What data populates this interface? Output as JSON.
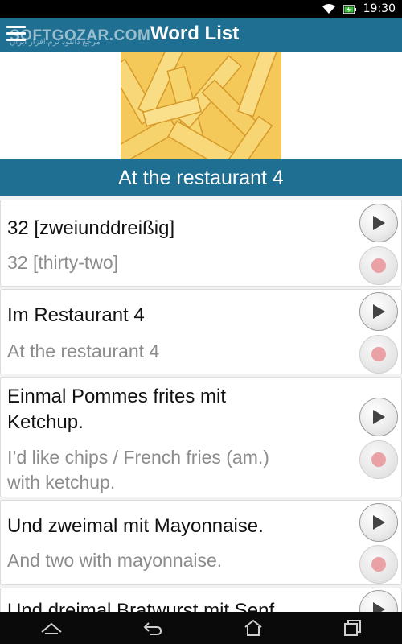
{
  "status_bar": {
    "time": "19:30",
    "icons": [
      "wifi-icon",
      "battery-charging-icon"
    ]
  },
  "app_bar": {
    "title": "Word List",
    "watermark": "SOFTGOZAR.COM",
    "watermark_sub": "مرجع دانلود نرم افزار ایران",
    "menu_icon": "hamburger-menu-icon"
  },
  "hero": {
    "image": "french-fries-photo"
  },
  "section": {
    "title": "At the restaurant 4"
  },
  "phrases": [
    {
      "german": "32 [zweiunddreißig]",
      "english": "32 [thirty-two]"
    },
    {
      "german": "Im Restaurant 4",
      "english": "At the restaurant 4"
    },
    {
      "german_lines": [
        "Einmal Pommes frites mit",
        "Ketchup."
      ],
      "english_lines": [
        "I’d like chips / French fries (am.)",
        "with ketchup."
      ]
    },
    {
      "german": "Und zweimal mit Mayonnaise.",
      "english": "And two with mayonnaise."
    },
    {
      "german": "Und dreimal Bratwurst mit Senf."
    }
  ],
  "colors": {
    "primary": "#1e6f92",
    "record_dot": "#e9a1a6",
    "secondary_text": "#8c8c8c"
  },
  "nav_bar": {
    "icons": [
      "home-icon",
      "back-icon",
      "system-home-icon",
      "recents-icon"
    ]
  }
}
